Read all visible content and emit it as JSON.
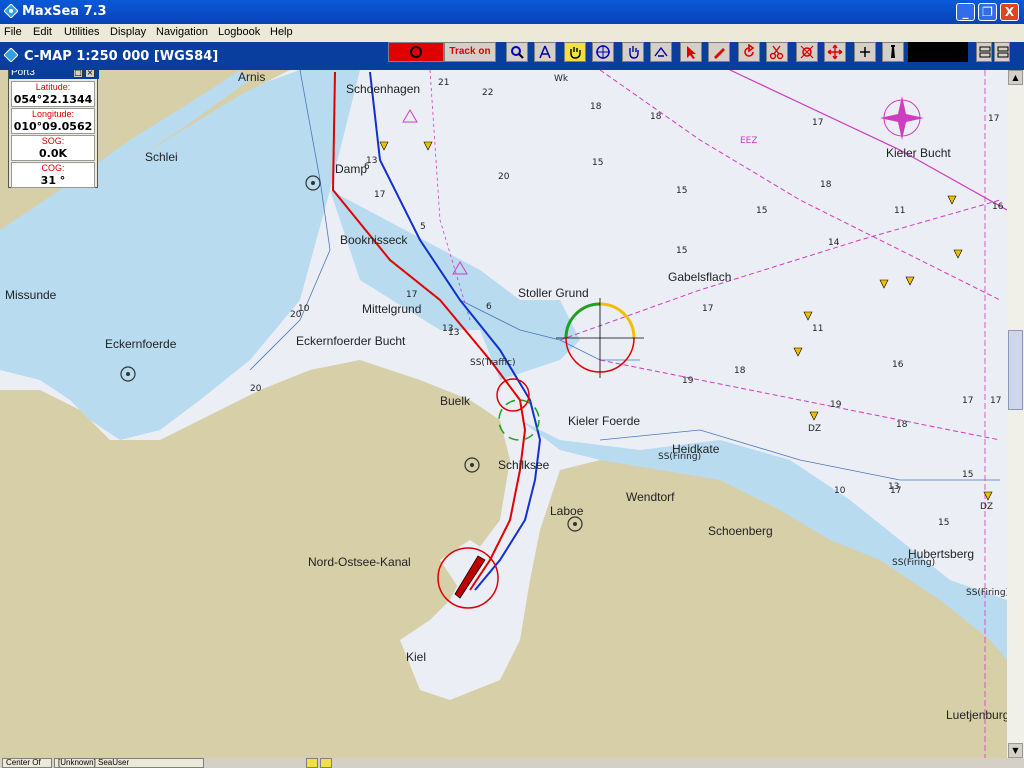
{
  "window": {
    "title": "MaxSea 7.3",
    "min_glyph": "_",
    "max_glyph": "❐",
    "close_glyph": "X"
  },
  "menu": [
    "File",
    "Edit",
    "Utilities",
    "Display",
    "Navigation",
    "Logbook",
    "Help"
  ],
  "chart_header": "C-MAP  1:250 000 [WGS84]",
  "toolbar": {
    "track_label": "Track on",
    "icons": [
      "record-icon",
      "zoom-icon",
      "compass-icon",
      "hand-icon",
      "crosshair-icon",
      "pan-icon",
      "measure-icon",
      "pointer-icon",
      "pencil-icon",
      "rotate-icon",
      "scissors-icon",
      "route-icon",
      "move-icon",
      "plus-icon",
      "lighthouse-icon"
    ]
  },
  "panel": {
    "title": "Port3",
    "fields": [
      {
        "label": "Latitude:",
        "value": "054°22.1344 N"
      },
      {
        "label": "Longitude:",
        "value": "010°09.0562 E"
      },
      {
        "label": "SOG:",
        "value": "0.0K"
      },
      {
        "label": "COG:",
        "value": "31 °"
      }
    ]
  },
  "places": [
    "Arnis",
    "Schoenhagen",
    "Schlei",
    "Damp",
    "Missunde",
    "Booknisseck",
    "Mittelgrund",
    "Eckernfoerde",
    "Eckernfoerder Bucht",
    "Stoller Grund",
    "Gabelsflach",
    "Kieler Bucht",
    "Buelk",
    "Kieler Foerde",
    "Heidkate",
    "Schilksee",
    "Laboe",
    "Wendtorf",
    "Schoenberg",
    "Nord-Ostsee-Kanal",
    "Hubertsberg",
    "Kiel",
    "Luetjenburg"
  ],
  "depths": [
    "21",
    "22",
    "18",
    "18",
    "20",
    "15",
    "13",
    "17",
    "15",
    "11",
    "18",
    "17",
    "15",
    "14",
    "13",
    "17",
    "11",
    "16",
    "17",
    "19",
    "18",
    "17",
    "18",
    "19",
    "15",
    "17",
    "17",
    "16",
    "15",
    "15",
    "13",
    "13",
    "17",
    "6",
    "5",
    "6",
    "10",
    "10",
    "20",
    "20"
  ],
  "chart_labels": [
    "SS(Traffic)",
    "SS(Firing)",
    "SS(Firing)",
    "SS(Firing)",
    "EEZ",
    "Wk",
    "DZ",
    "DZ"
  ],
  "statusbar": {
    "left": "Center Of",
    "user": "[Unknown] SeaUser"
  }
}
